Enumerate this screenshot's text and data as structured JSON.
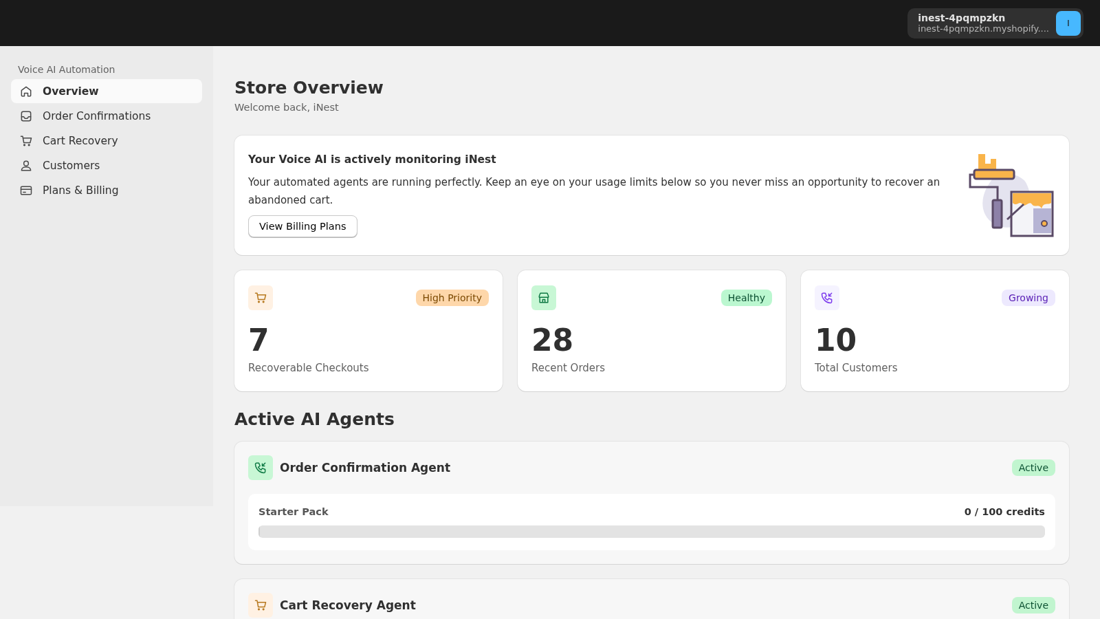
{
  "topbar": {
    "store_name": "inest-4pqmpzkn",
    "store_domain": "inest-4pqmpzkn.myshopify....",
    "avatar": "I"
  },
  "sidebar": {
    "section": "Voice AI Automation",
    "items": [
      {
        "label": "Overview",
        "kind": "home",
        "selected": true
      },
      {
        "label": "Order Confirmations",
        "kind": "inbox",
        "selected": false
      },
      {
        "label": "Cart Recovery",
        "kind": "cart",
        "selected": false
      },
      {
        "label": "Customers",
        "kind": "person",
        "selected": false
      },
      {
        "label": "Plans & Billing",
        "kind": "card",
        "selected": false
      }
    ]
  },
  "header": {
    "title": "Store Overview",
    "subtitle": "Welcome back, iNest"
  },
  "banner": {
    "title": "Your Voice AI is actively monitoring iNest",
    "text": "Your automated agents are running perfectly. Keep an eye on your usage limits below so you never miss an opportunity to recover an abandoned cart.",
    "button": "View Billing Plans"
  },
  "stats": [
    {
      "kind": "cart",
      "badge": "High Priority",
      "color": "#fed7aa",
      "value": "7",
      "label": "Recoverable Checkouts"
    },
    {
      "kind": "store",
      "badge": "Healthy",
      "color": "#bbf7d0",
      "value": "28",
      "label": "Recent Orders"
    },
    {
      "kind": "phone",
      "badge": "Growing",
      "color": "#ede9fe",
      "value": "10",
      "label": "Total Customers"
    }
  ],
  "agents_title": "Active AI Agents",
  "agents": [
    {
      "kind": "phone",
      "name": "Order Confirmation Agent",
      "status": "Active",
      "usage": {
        "plan": "Starter Pack",
        "credits": "0 / 100 credits",
        "level": 0
      }
    },
    {
      "kind": "cart",
      "name": "Cart Recovery Agent",
      "status": "Active"
    }
  ]
}
